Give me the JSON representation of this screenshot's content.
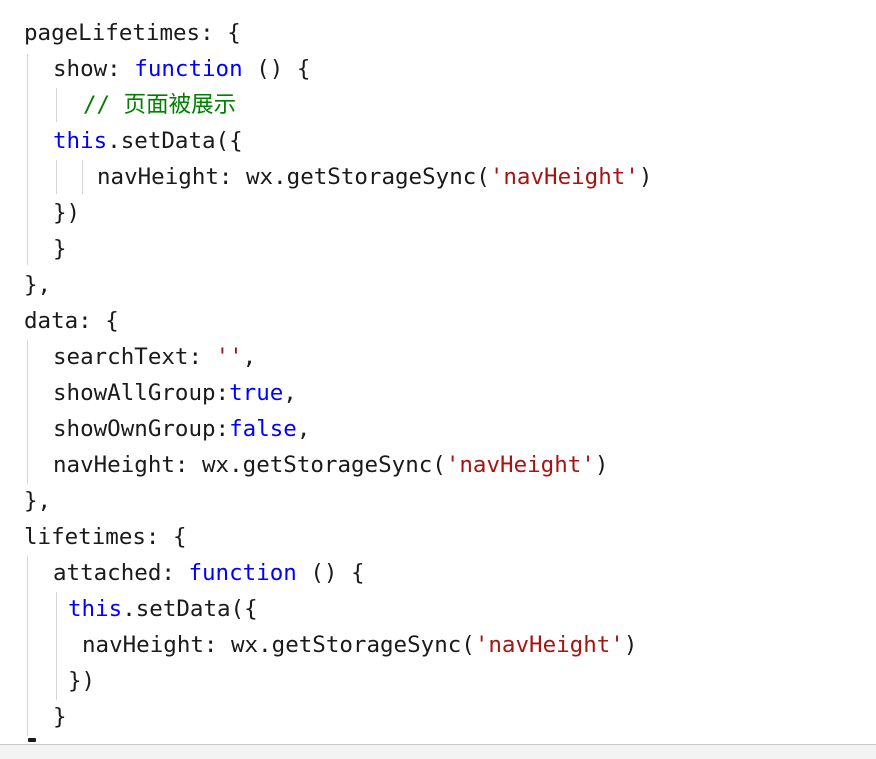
{
  "code": {
    "lines": [
      [
        {
          "t": "pageLifetimes: {"
        }
      ],
      [
        {
          "t": "show: "
        },
        {
          "t": "function",
          "c": "kw"
        },
        {
          "t": " () {"
        }
      ],
      [
        {
          "t": "// 页面被展示",
          "c": "cmt"
        }
      ],
      [
        {
          "t": "this",
          "c": "kw"
        },
        {
          "t": ".setData({"
        }
      ],
      [
        {
          "t": "navHeight: wx.getStorageSync("
        },
        {
          "t": "'navHeight'",
          "c": "str"
        },
        {
          "t": ")"
        }
      ],
      [
        {
          "t": "})"
        }
      ],
      [
        {
          "t": "}"
        }
      ],
      [
        {
          "t": "},"
        }
      ],
      [
        {
          "t": "data: {"
        }
      ],
      [
        {
          "t": "searchText: "
        },
        {
          "t": "''",
          "c": "str"
        },
        {
          "t": ","
        }
      ],
      [
        {
          "t": "showAllGroup:"
        },
        {
          "t": "true",
          "c": "kw"
        },
        {
          "t": ","
        }
      ],
      [
        {
          "t": "showOwnGroup:"
        },
        {
          "t": "false",
          "c": "kw"
        },
        {
          "t": ","
        }
      ],
      [
        {
          "t": "navHeight: wx.getStorageSync("
        },
        {
          "t": "'navHeight'",
          "c": "str"
        },
        {
          "t": ")"
        }
      ],
      [
        {
          "t": "},"
        }
      ],
      [
        {
          "t": "lifetimes: {"
        }
      ],
      [
        {
          "t": "attached: "
        },
        {
          "t": "function",
          "c": "kw"
        },
        {
          "t": " () {"
        }
      ],
      [
        {
          "t": "this",
          "c": "kw"
        },
        {
          "t": ".setData({"
        }
      ],
      [
        {
          "t": "navHeight: wx.getStorageSync("
        },
        {
          "t": "'navHeight'",
          "c": "str"
        },
        {
          "t": ")"
        }
      ],
      [
        {
          "t": "})"
        }
      ],
      [
        {
          "t": "}"
        }
      ]
    ]
  },
  "colors": {
    "keyword": "#0000ff",
    "string": "#a31515",
    "comment": "#008000",
    "text": "#1a1a1a",
    "indent_guide": "#d4d4d4",
    "background": "#ffffff"
  }
}
